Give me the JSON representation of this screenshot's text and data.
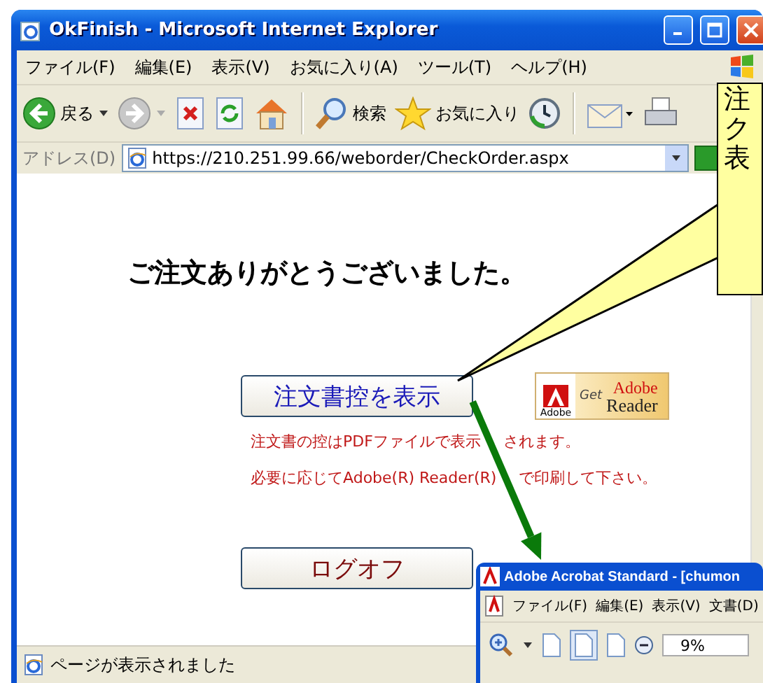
{
  "browser": {
    "title": "OkFinish - Microsoft Internet Explorer",
    "menu": [
      "ファイル(F)",
      "編集(E)",
      "表示(V)",
      "お気に入り(A)",
      "ツール(T)",
      "ヘルプ(H)"
    ],
    "toolbar": [
      {
        "kind": "back",
        "label": "戻る"
      },
      {
        "kind": "forward"
      },
      {
        "kind": "stop"
      },
      {
        "kind": "refresh"
      },
      {
        "kind": "home"
      },
      {
        "kind": "search",
        "label": "検索"
      },
      {
        "kind": "favorites",
        "label": "お気に入り"
      },
      {
        "kind": "history"
      },
      {
        "kind": "mail"
      },
      {
        "kind": "print"
      }
    ],
    "address": {
      "label": "アドレス(D)",
      "value": "https://210.251.99.66/weborder/CheckOrder.aspx"
    },
    "page": {
      "heading": "ご注文ありがとうございました。",
      "show_button": "注文書控を表示",
      "badge": {
        "brand": "Adobe",
        "get": "Get",
        "product_top": "Adobe",
        "product": "Reader"
      },
      "notes": [
        "注文書の控はPDFファイルで表示されます。",
        "必要に応じてAdobe(R) Reader(R)で印刷して下さい。"
      ],
      "logoff_button": "ログオフ"
    },
    "status": "ページが表示されました"
  },
  "callout": {
    "lines": [
      "注",
      "ク",
      "表"
    ]
  },
  "acrobat": {
    "title": "Adobe Acrobat Standard - [chumon",
    "menu": [
      "ファイル(F)",
      "編集(E)",
      "表示(V)",
      "文書(D)"
    ],
    "zoom": "9%"
  }
}
